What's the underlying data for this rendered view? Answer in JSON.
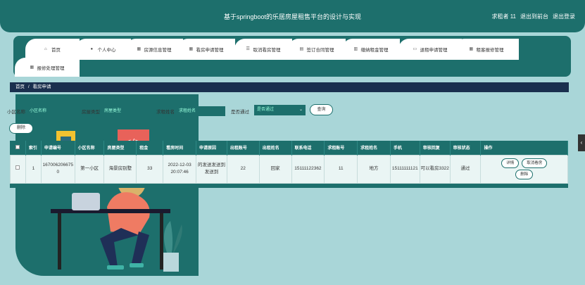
{
  "header": {
    "title": "基于springboot的乐居房屋租售平台的设计与实现",
    "user_label": "求租者 11",
    "back_link": "退出到前台",
    "logout_link": "退出登录"
  },
  "nav": {
    "items": [
      {
        "label": "首页",
        "icon": "home-icon"
      },
      {
        "label": "个人中心",
        "icon": "user-icon"
      },
      {
        "label": "房源信息管理",
        "icon": "grid-icon"
      },
      {
        "label": "看房申请管理",
        "icon": "grid-icon"
      },
      {
        "label": "取消看房管理",
        "icon": "sliders-icon"
      },
      {
        "label": "签订合同管理",
        "icon": "calendar-icon"
      },
      {
        "label": "缴纳租金管理",
        "icon": "chart-icon"
      },
      {
        "label": "退租申请管理",
        "icon": "monitor-icon"
      },
      {
        "label": "租客报修管理",
        "icon": "grid-icon"
      },
      {
        "label": "报修处理管理",
        "icon": "grid-icon"
      }
    ]
  },
  "breadcrumb": {
    "home": "首页",
    "separator": "/",
    "current": "看房申请"
  },
  "search": {
    "field1_label": "小区名称",
    "field1_placeholder": "小区名称",
    "field2_label": "房屋类型",
    "field2_placeholder": "房屋类型",
    "field3_label": "求租姓名",
    "field3_placeholder": "求租姓名",
    "field4_label": "是否通过",
    "field4_value": "是否通过",
    "query_button": "查询"
  },
  "toolbar": {
    "delete_button": "删除"
  },
  "table": {
    "headers": [
      "",
      "索引",
      "申请编号",
      "小区名称",
      "房屋类型",
      "租金",
      "看房时间",
      "申请原因",
      "出租账号",
      "出租姓名",
      "联系电话",
      "求租账号",
      "求租姓名",
      "手机",
      "审核回复",
      "审核状态",
      "操作"
    ],
    "rows": [
      {
        "index": "1",
        "apply_no": "1670062066750",
        "community": "第一小区",
        "house_type": "海景房别墅",
        "rent": "33",
        "view_time": "2022-12-03 20:07:46",
        "reason": "的发送发送到发送到",
        "landlord_account": "22",
        "landlord_name": "回家",
        "phone": "15111122362",
        "tenant_account": "11",
        "tenant_name": "地方",
        "mobile": "15111111121",
        "reply": "可以看房3322",
        "status": "通过",
        "actions": [
          "详情",
          "取消看房",
          "删除"
        ]
      }
    ]
  },
  "colors": {
    "primary": "#1d6f6c",
    "background": "#a9d6d8",
    "breadcrumb_bg": "#1a2f4e"
  }
}
